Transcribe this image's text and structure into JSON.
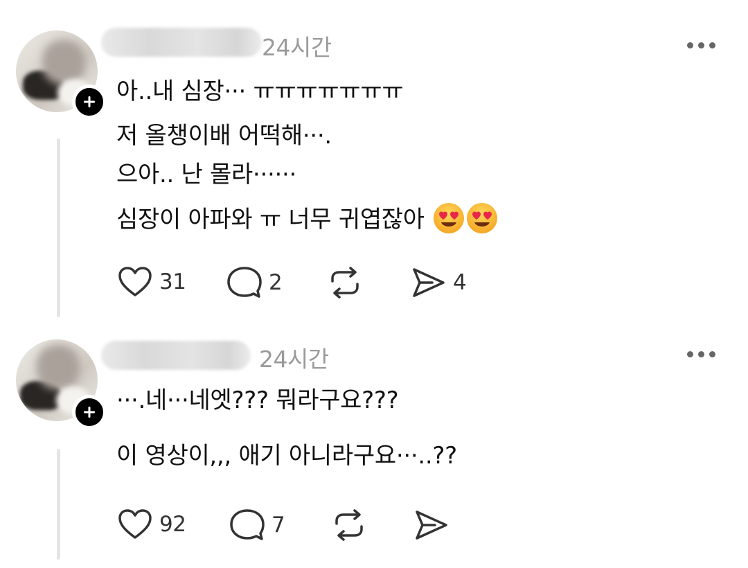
{
  "posts": [
    {
      "timestamp": "24시간",
      "body_lines": [
        "아..내 심장··· ㅠㅠㅠㅠㅠㅠㅠ",
        "저 올챙이배 어떡해···.",
        "으아.. 난 몰라······",
        "심장이 아파와 ㅠ 너무 귀엽잖아"
      ],
      "emoji": [
        "heart-eyes-emoji",
        "heart-eyes-emoji"
      ],
      "actions": {
        "likes": "31",
        "replies": "2",
        "reposts": "",
        "shares": "4"
      }
    },
    {
      "timestamp": "24시간",
      "body_lines": [
        "···.네···네엣??? 뭐라구요???",
        "이 영상이,,, 애기 아니라구요···..??"
      ],
      "actions": {
        "likes": "92",
        "replies": "7",
        "reposts": "",
        "shares": ""
      }
    }
  ],
  "icons": {
    "like": "heart-icon",
    "reply": "comment-bubble-icon",
    "repost": "repost-icon",
    "share": "send-icon",
    "more": "more-options-icon",
    "follow": "plus-icon"
  },
  "colors": {
    "follow_badge": "#000000",
    "timestamp": "#9a9a9a",
    "icon": "#333333",
    "thread_line": "#e4e4e4"
  }
}
